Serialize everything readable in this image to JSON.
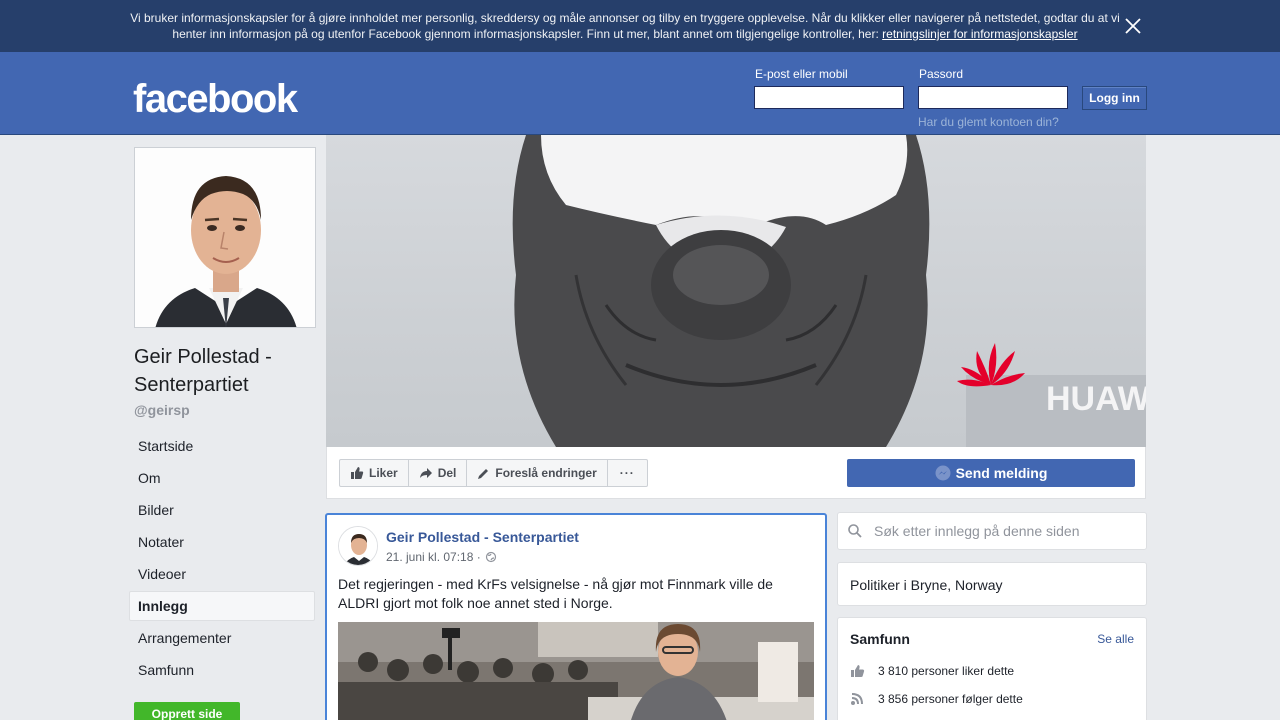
{
  "cookie_banner": {
    "text": "Vi bruker informasjonskapsler for å gjøre innholdet mer personlig, skreddersy og måle annonser og tilby en tryggere opplevelse. Når du klikker eller navigerer på nettstedet, godtar du at vi henter inn informasjon på og utenfor Facebook gjennom informasjonskapsler. Finn ut mer, blant annet om tilgjengelige kontroller, her: ",
    "link": "retningslinjer for informasjonskapsler"
  },
  "header": {
    "logo": "facebook",
    "email_label": "E-post eller mobil",
    "password_label": "Passord",
    "login_button": "Logg inn",
    "forgot_link": "Har du glemt kontoen din?"
  },
  "profile": {
    "name": "Geir Pollestad - Senterpartiet",
    "handle": "@geirsp"
  },
  "nav": {
    "items": [
      "Startside",
      "Om",
      "Bilder",
      "Notater",
      "Videoer",
      "Innlegg",
      "Arrangementer",
      "Samfunn"
    ],
    "active_index": 5
  },
  "create_button": "Opprett side",
  "actions": {
    "like": "Liker",
    "share": "Del",
    "suggest": "Foreslå endringer",
    "more": "···",
    "send_message": "Send melding"
  },
  "post": {
    "author": "Geir Pollestad - Senterpartiet",
    "time": "21. juni kl. 07:18 ·",
    "text": "Det regjeringen - med KrFs velsignelse - nå gjør mot Finnmark ville de ALDRI gjort mot folk noe annet sted i Norge."
  },
  "sidebar": {
    "search_placeholder": "Søk etter innlegg på denne siden",
    "about": "Politiker i Bryne, Norway",
    "community_title": "Samfunn",
    "see_all": "Se alle",
    "likes": "3 810 personer liker dette",
    "follows": "3 856 personer følger dette"
  },
  "colors": {
    "brand_blue": "#4267b2",
    "banner_blue": "#263f6b",
    "link_blue": "#385898",
    "green": "#42b72a",
    "huawei_red": "#e4002b"
  }
}
